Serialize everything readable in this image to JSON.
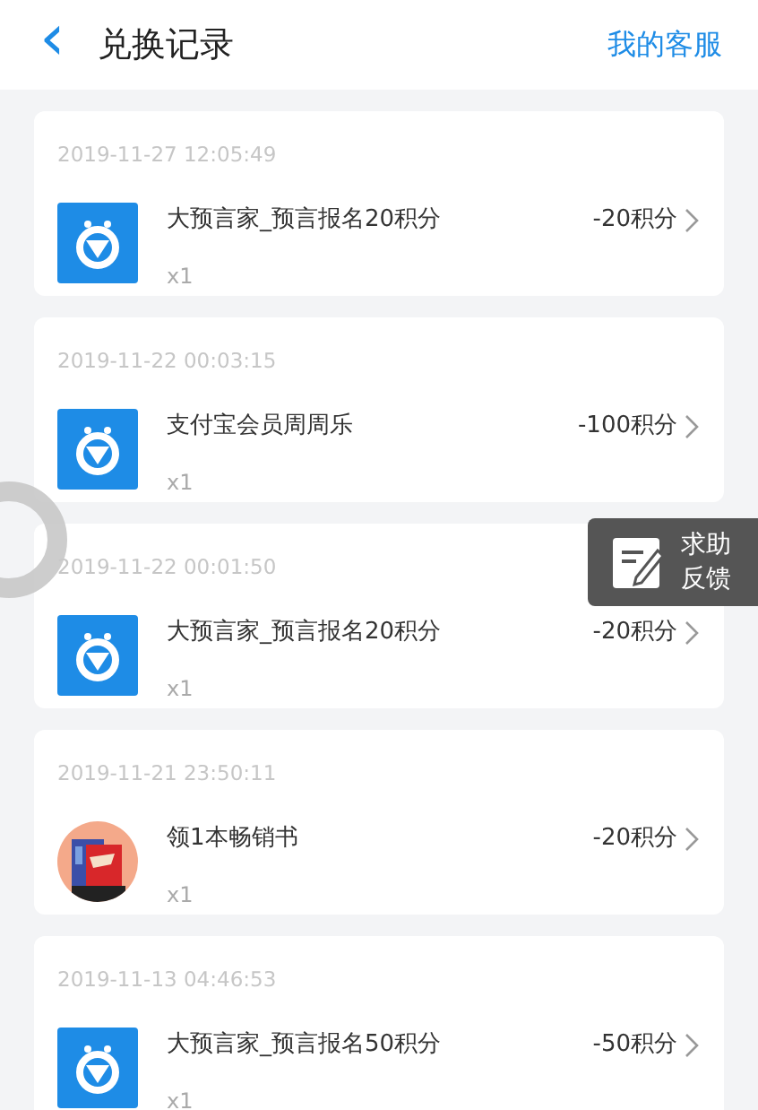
{
  "header": {
    "back_icon": "‹",
    "title": "兑换记录",
    "action": "我的客服"
  },
  "records": [
    {
      "time": "2019-11-27 12:05:49",
      "thumbnail": {
        "kind": "app"
      },
      "name": "大预言家_预言报名20积分",
      "quantity": "x1",
      "points": "-20积分"
    },
    {
      "time": "2019-11-22 00:03:15",
      "thumbnail": {
        "kind": "app"
      },
      "name": "支付宝会员周周乐",
      "quantity": "x1",
      "points": "-100积分"
    },
    {
      "time": "2019-11-22 00:01:50",
      "thumbnail": {
        "kind": "app"
      },
      "name": "大预言家_预言报名20积分",
      "quantity": "x1",
      "points": "-20积分"
    },
    {
      "time": "2019-11-21 23:50:11",
      "name": "领1本畅销书",
      "quantity": "x1",
      "points": "-20积分"
    },
    {
      "time": "2019-11-13 04:46:53",
      "thumbnail": {
        "kind": "app"
      },
      "name": "大预言家_预言报名50积分",
      "quantity": "x1",
      "points": "-50积分"
    }
  ],
  "help_button": {
    "label": "求助反馈"
  }
}
